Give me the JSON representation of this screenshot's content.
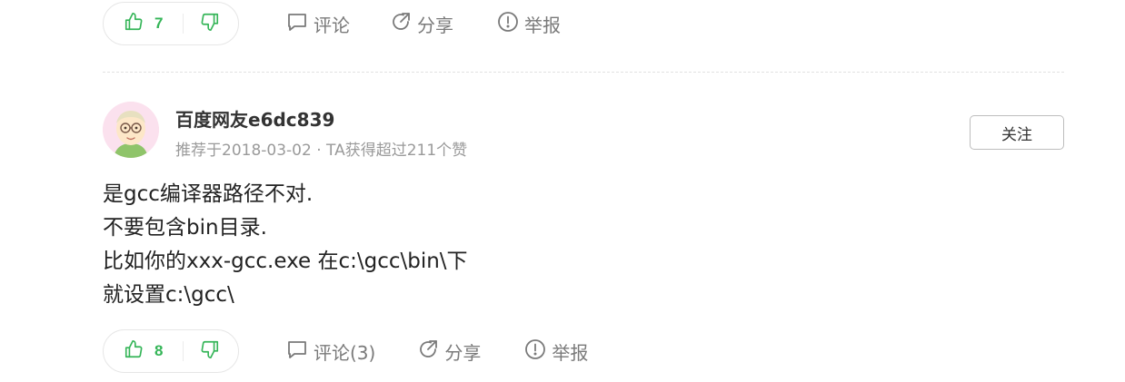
{
  "top_bar": {
    "upvote_count": "7",
    "comment_label": "评论",
    "share_label": "分享",
    "report_label": "举报"
  },
  "answer": {
    "user_name": "百度网友e6dc839",
    "meta": "推荐于2018-03-02 · TA获得超过211个赞",
    "follow_label": "关注",
    "body_lines": [
      "是gcc编译器路径不对.",
      "不要包含bin目录.",
      "比如你的xxx-gcc.exe 在c:\\gcc\\bin\\下",
      "就设置c:\\gcc\\"
    ]
  },
  "bottom_bar": {
    "upvote_count": "8",
    "comment_label": "评论(3)",
    "share_label": "分享",
    "report_label": "举报"
  },
  "colors": {
    "accent_green": "#35b558",
    "muted_gray": "#7a7a7a",
    "meta_gray": "#9a9a9a"
  },
  "icons": [
    "thumbs-up-icon",
    "thumbs-down-icon",
    "comment-icon",
    "share-icon",
    "report-icon"
  ]
}
